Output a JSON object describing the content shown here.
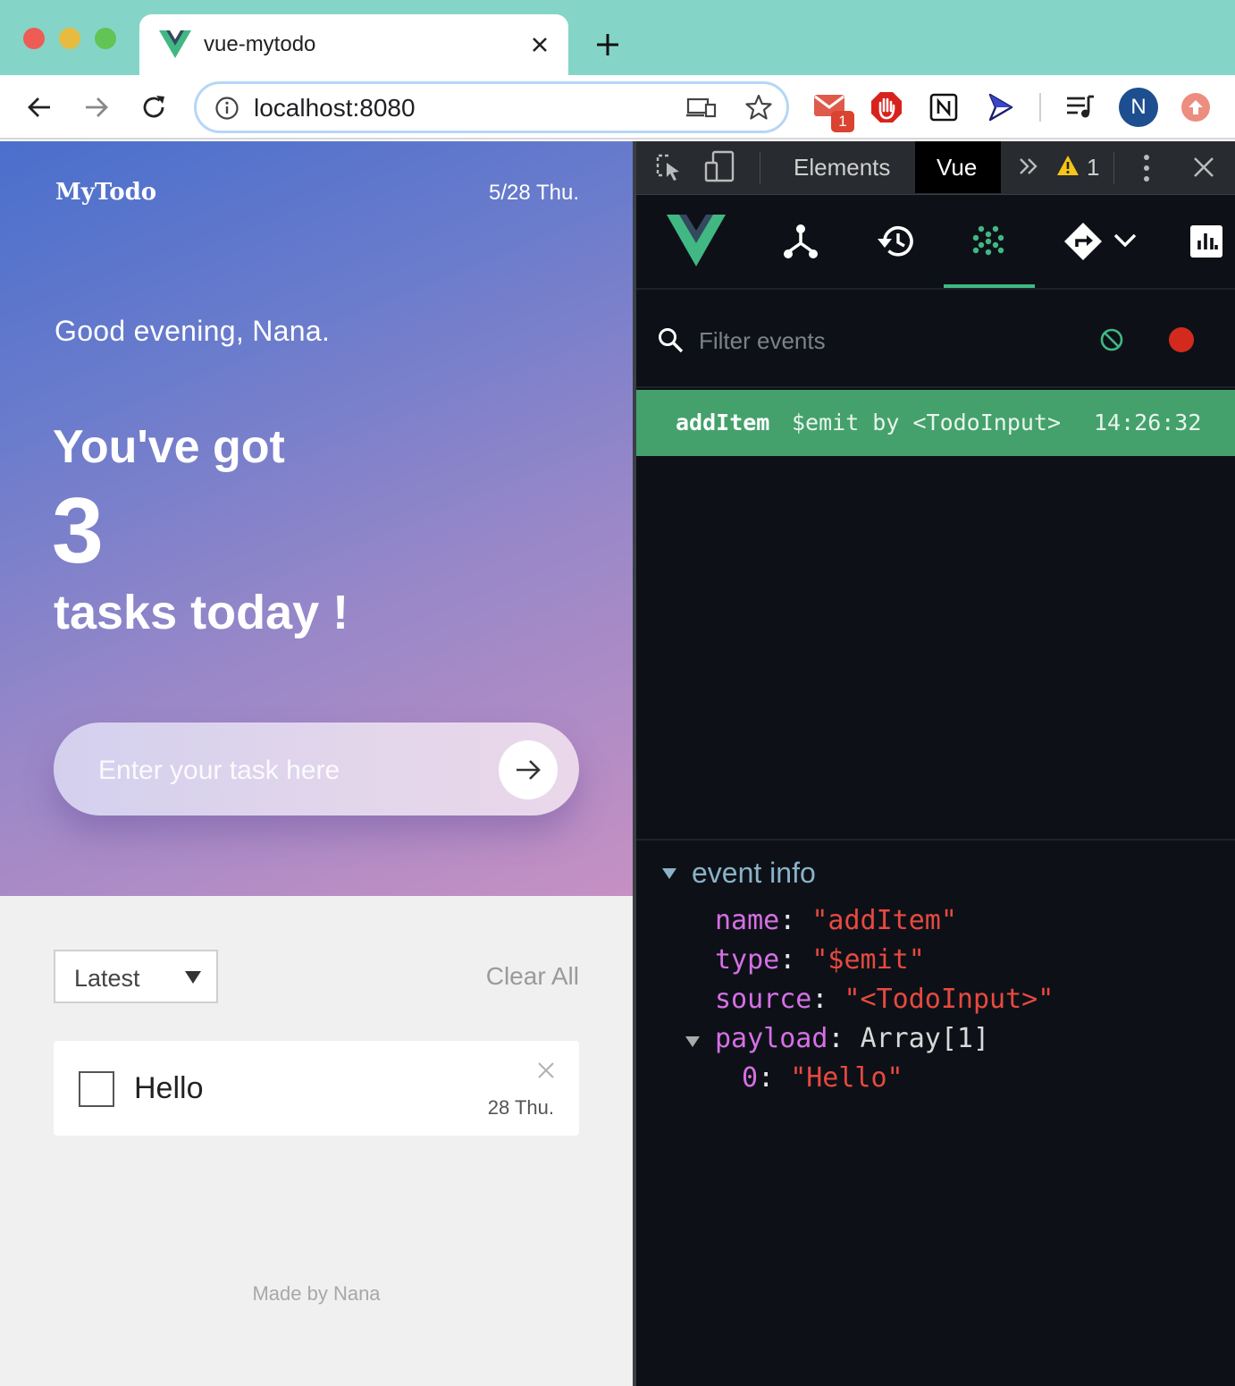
{
  "browser": {
    "tab_title": "vue-mytodo",
    "url": "localhost:8080",
    "gmail_badge": "1",
    "profile_initial": "N",
    "accent_colors": {
      "tab_bar": "#84d5c7",
      "omnibox_focus": "#b6d6f6"
    }
  },
  "app": {
    "brand": "MyTodo",
    "date": "5/28 Thu.",
    "greeting": "Good evening, Nana.",
    "headline_top": "You've got",
    "task_count": "3",
    "headline_bottom": "tasks today !",
    "input_placeholder": "Enter your task here",
    "sort_selected": "Latest",
    "clear_all_label": "Clear All",
    "todos": [
      {
        "text": "Hello",
        "date": "28 Thu.",
        "done": false
      }
    ],
    "footer": "Made by Nana"
  },
  "devtools": {
    "tabs": {
      "elements": "Elements",
      "vue": "Vue"
    },
    "warning_count": "1",
    "filter_placeholder": "Filter events",
    "events": [
      {
        "name": "addItem",
        "description": "$emit by <TodoInput>",
        "time": "14:26:32"
      }
    ],
    "event_info": {
      "title": "event info",
      "name_key": "name",
      "name_value": "\"addItem\"",
      "type_key": "type",
      "type_value": "\"$emit\"",
      "source_key": "source",
      "source_value": "\"<TodoInput>\"",
      "payload_key": "payload",
      "payload_value": "Array[1]",
      "payload_index": "0",
      "payload_item": "\"Hello\""
    },
    "accent_colors": {
      "vue_green": "#41b883",
      "event_row": "#44a16c",
      "record": "#d42a1e"
    }
  }
}
